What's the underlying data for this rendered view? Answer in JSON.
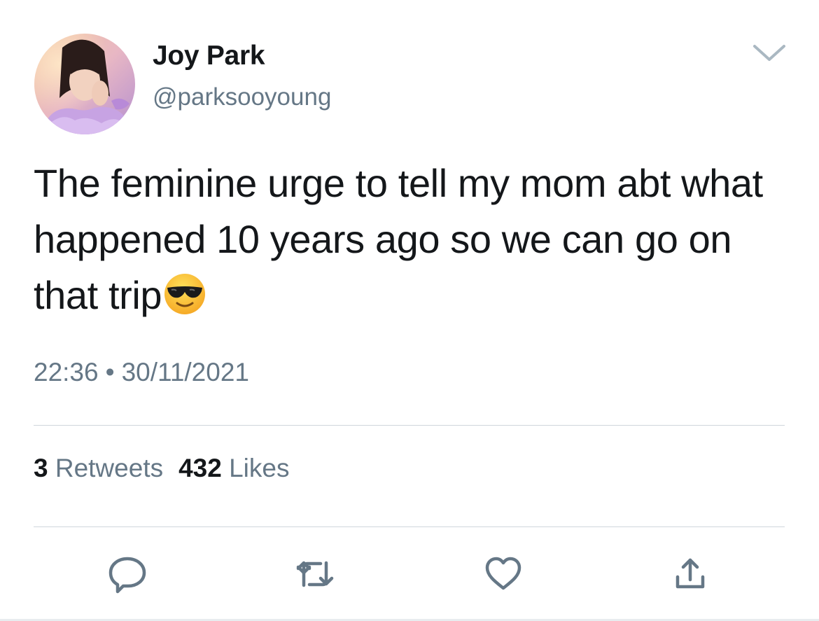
{
  "tweet": {
    "author": {
      "display_name": "Joy Park",
      "handle": "@parksooyoung",
      "avatar_icon": "profile-photo"
    },
    "text_before_emoji": "The feminine urge to tell my mom abt what happened 10 years ago so we can go on that trip",
    "emoji": "smiling-face-with-sunglasses",
    "time": "22:36",
    "separator": "•",
    "date": "30/11/2021",
    "stats": {
      "retweets_count": "3",
      "retweets_label": "Retweets",
      "likes_count": "432",
      "likes_label": "Likes"
    },
    "actions": [
      {
        "name": "reply",
        "icon": "speech-bubble-icon"
      },
      {
        "name": "retweet",
        "icon": "retweet-arrows-icon"
      },
      {
        "name": "like",
        "icon": "heart-icon"
      },
      {
        "name": "share",
        "icon": "share-upload-icon"
      }
    ]
  },
  "colors": {
    "text_primary": "#14171a",
    "text_secondary": "#657786",
    "icon": "#657786",
    "divider": "#cfd6dc"
  }
}
